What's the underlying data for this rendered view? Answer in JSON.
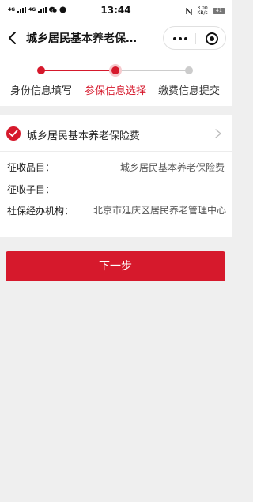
{
  "status_bar": {
    "time": "13:44",
    "signal_1_label": "4G",
    "signal_2_label": "4G",
    "network_speed": "3.00 KB/s",
    "battery": "41",
    "nfc_icon": "nfc-icon",
    "wechat_icon": "wechat-icon"
  },
  "nav": {
    "title": "城乡居民基本养老保…",
    "back_icon": "chevron-left-icon",
    "more_icon": "more-dots-icon",
    "close_icon": "target-circle-icon"
  },
  "steps": [
    {
      "label": "身份信息填写",
      "state": "done"
    },
    {
      "label": "参保信息选择",
      "state": "active"
    },
    {
      "label": "缴费信息提交",
      "state": "pending"
    }
  ],
  "card": {
    "title": "城乡居民基本养老保险费",
    "rows": [
      {
        "label": "征收品目：",
        "value": "城乡居民基本养老保险费"
      },
      {
        "label": "征收子目：",
        "value": ""
      },
      {
        "label": "社保经办机构：",
        "value": "北京市延庆区居民养老管理中心"
      }
    ]
  },
  "actions": {
    "next_label": "下一步"
  },
  "colors": {
    "accent": "#d6192c",
    "pending": "#cccccc",
    "background": "#efefef"
  }
}
